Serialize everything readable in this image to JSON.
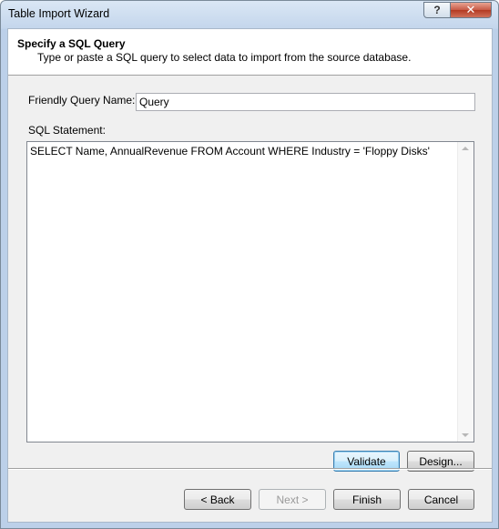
{
  "window": {
    "title": "Table Import Wizard",
    "help_label": "?",
    "close_label": "✕"
  },
  "header": {
    "title": "Specify a SQL Query",
    "description": "Type or paste a SQL query to select data to import from the source database."
  },
  "form": {
    "friendly_name_label": "Friendly Query Name:",
    "friendly_name_value": "Query",
    "sql_label": "SQL Statement:",
    "sql_value": "SELECT Name, AnnualRevenue FROM Account WHERE Industry = 'Floppy Disks'"
  },
  "actions": {
    "validate": "Validate",
    "design": "Design..."
  },
  "footer": {
    "back": "< Back",
    "next": "Next >",
    "finish": "Finish",
    "cancel": "Cancel"
  }
}
